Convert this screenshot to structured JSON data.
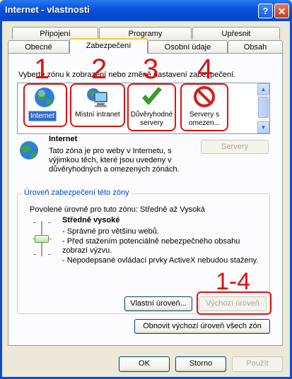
{
  "window": {
    "title": "Internet - vlastnosti",
    "help_glyph": "?",
    "close_glyph": "✕"
  },
  "tabs": {
    "row_back": [
      "Připojení",
      "Programy",
      "Upřesnit"
    ],
    "row_front": [
      "Obecné",
      "Zabezpečení",
      "Osobní údaje",
      "Obsah"
    ],
    "active": "Zabezpečení"
  },
  "zones": {
    "instruction": "Vyberte zónu k zobrazení nebo změně nastavení zabezpečení.",
    "items": [
      {
        "label": "Internet",
        "icon": "globe-icon",
        "marker": "1"
      },
      {
        "label": "Místní intranet",
        "icon": "computer-icon",
        "marker": "2"
      },
      {
        "label": "Důvěryhodné servery",
        "icon": "checkmark-icon",
        "marker": "3"
      },
      {
        "label": "Servery s omezen...",
        "icon": "restricted-icon",
        "marker": "4"
      }
    ]
  },
  "zone_info": {
    "title": "Internet",
    "description": "Tato zóna je pro weby v Internetu, s výjimkou těch, které jsou uvedeny v důvěryhodných a omezených zónách.",
    "servers_button": "Servery"
  },
  "security_level": {
    "legend": "Úroveň zabezpečení této zóny",
    "allowed": "Povolené úrovně pro tuto zónu: Středně až Vysoká",
    "level_name": "Středně vysoké",
    "bullets": [
      "- Správné pro většinu webů.",
      "- Před stažením potenciálně nebezpečného obsahu zobrazí výzvu.",
      "- Nepodepsané ovládací prvky ActiveX nebudou staženy."
    ],
    "custom_button": "Vlastní úroveň...",
    "default_button": "Výchozí úroveň",
    "annotation": "1-4"
  },
  "reset_button": "Obnovit výchozí úroveň všech zón",
  "footer": {
    "ok": "OK",
    "cancel": "Storno",
    "apply": "Použít"
  },
  "colors": {
    "accent": "#0A55DC",
    "annotation_red": "#E01010",
    "active_tab_highlight": "#FFC73C"
  }
}
